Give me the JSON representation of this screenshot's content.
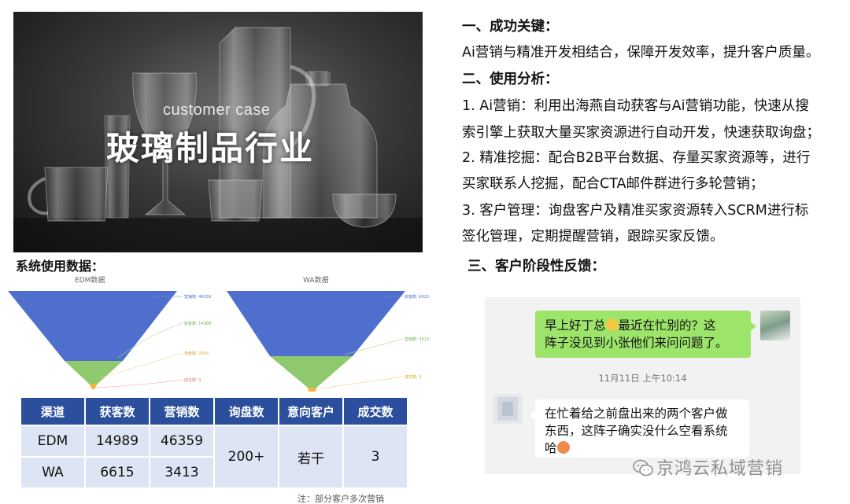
{
  "hero": {
    "subtitle": "customer case",
    "title": "玻璃制品行业"
  },
  "right": {
    "h1": "一、成功关键：",
    "key": "Ai营销与精准开发相结合，保障开发效率，提升客户质量。",
    "h2": "二、使用分析：",
    "a1_line1": "1. Ai营销：利用出海燕自动获客与Ai营销功能，快速从搜",
    "a1_line2": "索引擎上获取大量买家资源进行自动开发，快速获取询盘；",
    "a2_line1": "2. 精准挖掘：配合B2B平台数据、存量买家资源等，进行",
    "a2_line2": "买家联系人挖掘，配合CTA邮件群进行多轮营销；",
    "a3_line1": "3. 客户管理：询盘客户及精准买家资源转入SCRM进行标",
    "a3_line2": "签化管理，定期提醒营销，跟踪买家反馈。",
    "h3": "三、客户阶段性反馈："
  },
  "stats": {
    "title": "系统使用数据：",
    "edm_caption": "EDM数据",
    "wa_caption": "WA数据",
    "edm_labels": [
      "营销数: 46359",
      "获客数: 14989",
      "询盘数: 200+",
      "成交数: 3"
    ],
    "wa_labels": [
      "获客数: 6615",
      "营销数: 3413",
      "成交数: 3"
    ]
  },
  "table": {
    "headers": [
      "渠道",
      "获客数",
      "营销数",
      "询盘数",
      "意向客户",
      "成交数"
    ],
    "rows": [
      {
        "channel": "EDM",
        "acquired": "14989",
        "marketed": "46359"
      },
      {
        "channel": "WA",
        "acquired": "6615",
        "marketed": "3413"
      }
    ],
    "inquiries": "200+",
    "intent": "若干",
    "deals": "3",
    "note": "注：部分客户多次营销"
  },
  "chat": {
    "msg1_line1": "早上好丁总",
    "msg1_line1b": "最近在忙别的？这",
    "msg1_line2": "阵子没见到小张他们来问问题了。",
    "time": "11月11日 上午10:14",
    "msg2_line1": "在忙着给之前盘出来的两个客户做",
    "msg2_line2": "东西，这阵子确实没什么空看系统",
    "msg2_line3": "哈"
  },
  "watermark": "京鸿云私域营销",
  "colors": {
    "funnel_blue": "#4f6fcf",
    "funnel_green": "#8ec96d",
    "funnel_orange": "#f2b43c",
    "table_header": "#2b4f9c",
    "table_cell": "#dde4f3",
    "chat_green": "#9de46a"
  }
}
